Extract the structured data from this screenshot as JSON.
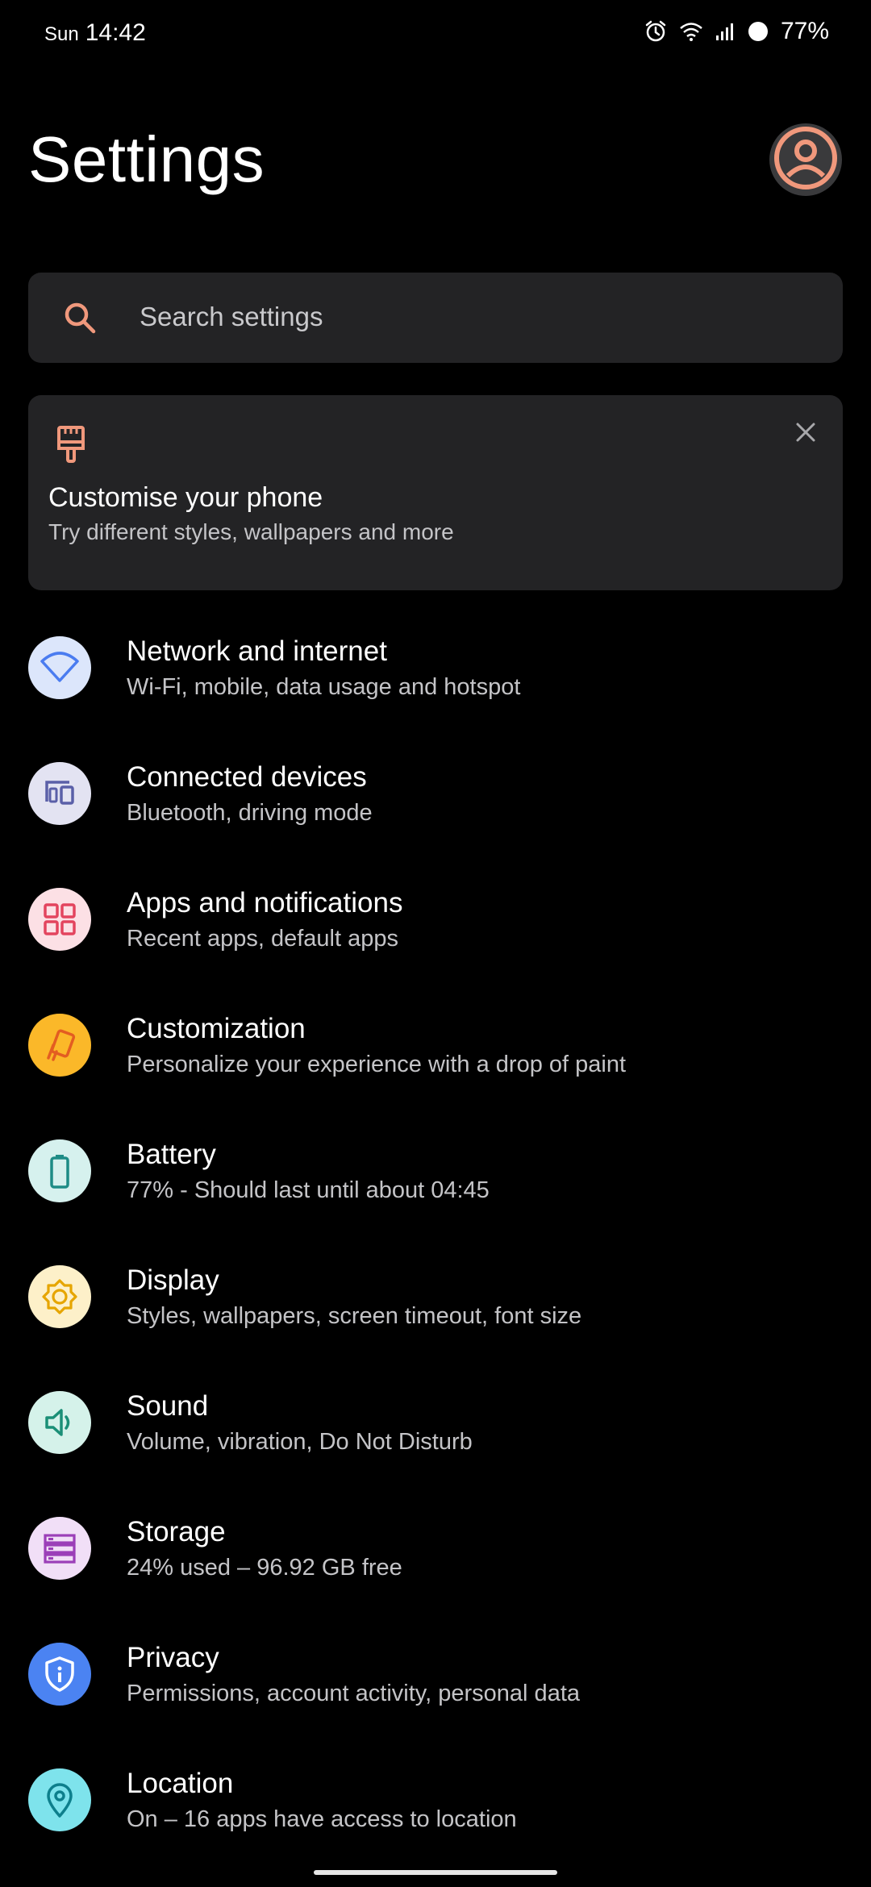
{
  "status_bar": {
    "day": "Sun",
    "time": "14:42",
    "battery": "77%",
    "icons": [
      "alarm-icon",
      "wifi-icon",
      "signal-icon",
      "battery-icon"
    ]
  },
  "header": {
    "title": "Settings",
    "avatar_icon": "account-circle-icon"
  },
  "search": {
    "placeholder": "Search settings",
    "icon": "search-icon"
  },
  "suggestion_card": {
    "icon": "paintbrush-icon",
    "title": "Customise your phone",
    "subtitle": "Try different styles, wallpapers and more",
    "close_icon": "close-icon"
  },
  "colors": {
    "accent": "#f0987c",
    "background": "#000000",
    "card": "#232325"
  },
  "items": [
    {
      "title": "Network and internet",
      "subtitle": "Wi-Fi, mobile, data usage and hotspot",
      "icon": "wifi-icon",
      "icon_bg": "#dce6fb",
      "icon_fg": "#4a7cf0"
    },
    {
      "title": "Connected devices",
      "subtitle": "Bluetooth, driving mode",
      "icon": "devices-icon",
      "icon_bg": "#e3e3f2",
      "icon_fg": "#5a5fa8"
    },
    {
      "title": "Apps and notifications",
      "subtitle": "Recent apps, default apps",
      "icon": "apps-grid-icon",
      "icon_bg": "#fce0e5",
      "icon_fg": "#e3445e"
    },
    {
      "title": "Customization",
      "subtitle": "Personalize your experience with a drop of paint",
      "icon": "paint-cards-icon",
      "icon_bg": "#fbb829",
      "icon_fg": "#e35d21"
    },
    {
      "title": "Battery",
      "subtitle": "77% - Should last until about 04:45",
      "icon": "battery-icon",
      "icon_bg": "#d6f1ee",
      "icon_fg": "#1e8c86"
    },
    {
      "title": "Display",
      "subtitle": "Styles, wallpapers, screen timeout, font size",
      "icon": "brightness-icon",
      "icon_bg": "#fdf0c9",
      "icon_fg": "#e6a500"
    },
    {
      "title": "Sound",
      "subtitle": "Volume, vibration, Do Not Disturb",
      "icon": "volume-icon",
      "icon_bg": "#d5f2ea",
      "icon_fg": "#1b8f77"
    },
    {
      "title": "Storage",
      "subtitle": "24% used – 96.92 GB free",
      "icon": "storage-icon",
      "icon_bg": "#f1dff7",
      "icon_fg": "#9b3fb8"
    },
    {
      "title": "Privacy",
      "subtitle": "Permissions, account activity, personal data",
      "icon": "privacy-shield-icon",
      "icon_bg": "#4b83f2",
      "icon_fg": "#ffffff"
    },
    {
      "title": "Location",
      "subtitle": "On – 16 apps have access to location",
      "icon": "location-pin-icon",
      "icon_bg": "#7ee3ec",
      "icon_fg": "#0d7f8c"
    }
  ]
}
